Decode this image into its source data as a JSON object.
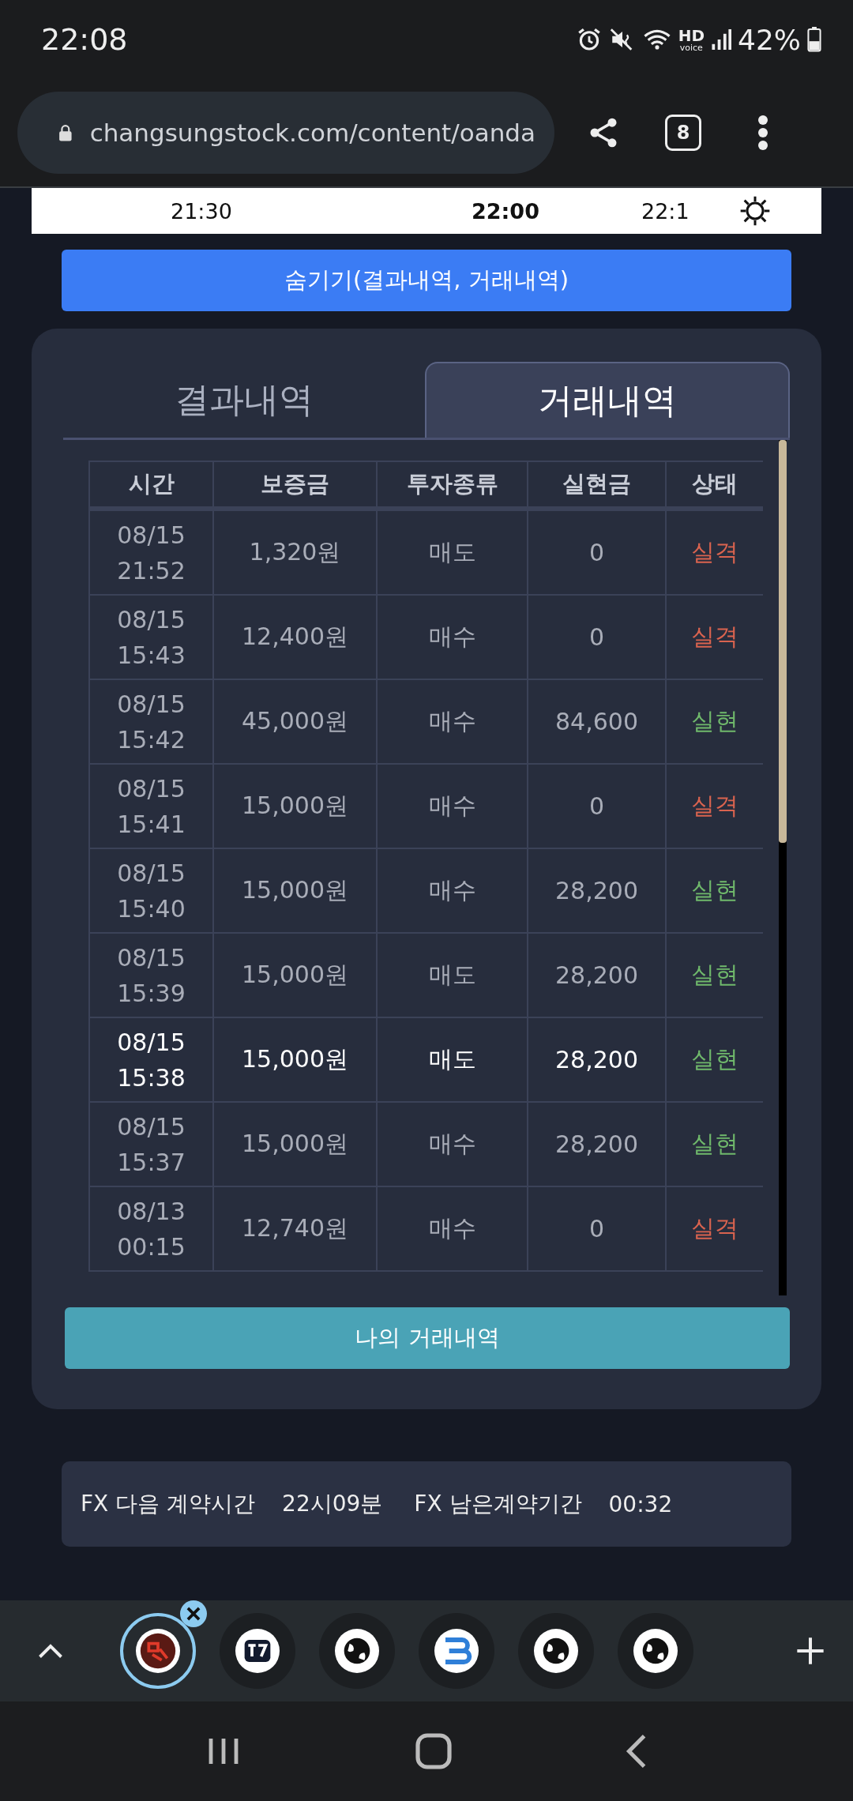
{
  "status_bar": {
    "time": "22:08",
    "network_label": "HD",
    "network_sublabel": "voice",
    "battery": "42%"
  },
  "browser": {
    "url": "changsungstock.com/content/oanda",
    "tab_count": "8"
  },
  "timeline": {
    "labels": [
      {
        "text": "21:30",
        "bold": false
      },
      {
        "text": "22:00",
        "bold": true
      },
      {
        "text": "22:1",
        "bold": false
      }
    ]
  },
  "hide_button": "숨기기(결과내역, 거래내역)",
  "tabs": [
    {
      "label": "결과내역",
      "selected": false
    },
    {
      "label": "거래내역",
      "selected": true
    }
  ],
  "table": {
    "columns": [
      "시간",
      "보증금",
      "투자종류",
      "실현금",
      "상태"
    ],
    "rows": [
      {
        "date": "08/15",
        "time": "21:52",
        "deposit": "1,320원",
        "type": "매도",
        "payout": "0",
        "status": "실격",
        "color": "#d9634f",
        "selected": false
      },
      {
        "date": "08/15",
        "time": "15:43",
        "deposit": "12,400원",
        "type": "매수",
        "payout": "0",
        "status": "실격",
        "color": "#d9634f",
        "selected": false
      },
      {
        "date": "08/15",
        "time": "15:42",
        "deposit": "45,000원",
        "type": "매수",
        "payout": "84,600",
        "status": "실현",
        "color": "#6fb86b",
        "selected": false
      },
      {
        "date": "08/15",
        "time": "15:41",
        "deposit": "15,000원",
        "type": "매수",
        "payout": "0",
        "status": "실격",
        "color": "#d9634f",
        "selected": false
      },
      {
        "date": "08/15",
        "time": "15:40",
        "deposit": "15,000원",
        "type": "매수",
        "payout": "28,200",
        "status": "실현",
        "color": "#6fb86b",
        "selected": false
      },
      {
        "date": "08/15",
        "time": "15:39",
        "deposit": "15,000원",
        "type": "매도",
        "payout": "28,200",
        "status": "실현",
        "color": "#6fb86b",
        "selected": false
      },
      {
        "date": "08/15",
        "time": "15:38",
        "deposit": "15,000원",
        "type": "매도",
        "payout": "28,200",
        "status": "실현",
        "color": "#6fb86b",
        "selected": true
      },
      {
        "date": "08/15",
        "time": "15:37",
        "deposit": "15,000원",
        "type": "매수",
        "payout": "28,200",
        "status": "실현",
        "color": "#6fb86b",
        "selected": false
      },
      {
        "date": "08/13",
        "time": "00:15",
        "deposit": "12,740원",
        "type": "매수",
        "payout": "0",
        "status": "실격",
        "color": "#d9634f",
        "selected": false
      }
    ]
  },
  "my_history_button": "나의 거래내역",
  "contract_info": [
    {
      "label": "FX 다음 계약시간",
      "value": "22시09분"
    },
    {
      "label": "FX 남은계약기간",
      "value": "00:32"
    }
  ],
  "dock": [
    {
      "kind": "emblem",
      "selected": true
    },
    {
      "kind": "square",
      "selected": false
    },
    {
      "kind": "globe",
      "selected": false
    },
    {
      "kind": "stripes",
      "selected": false
    },
    {
      "kind": "globe",
      "selected": false
    },
    {
      "kind": "globe",
      "selected": false
    }
  ]
}
